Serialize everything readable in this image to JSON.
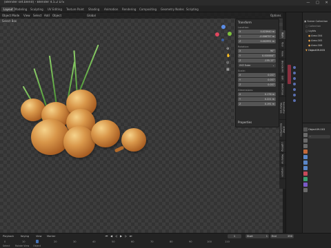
{
  "window": {
    "title": "[Blender set.blend] - Blender 4.5.2 LTS",
    "controls": [
      "—",
      "□",
      "✕"
    ]
  },
  "workspaces": [
    "Layout",
    "Modeling",
    "Sculpting",
    "UV Editing",
    "Texture Paint",
    "Shading",
    "Animation",
    "Rendering",
    "Compositing",
    "Geometry Nodes",
    "Scripting"
  ],
  "viewport": {
    "header": {
      "mode": "Object Mode",
      "view": "View",
      "select": "Select",
      "add": "Add",
      "object": "Object",
      "transform": "Global",
      "options": "Options"
    },
    "header2": {
      "label": "Select Box"
    }
  },
  "npanel": {
    "transform_header": "Transform",
    "location_label": "Location:",
    "location": [
      {
        "axis": "X",
        "value": "0.023940 m"
      },
      {
        "axis": "Y",
        "value": "-0.006757 m"
      },
      {
        "axis": "Z",
        "value": "0.002991 m"
      }
    ],
    "rotation_label": "Rotation:",
    "rotation": [
      {
        "axis": "X",
        "value": "90°"
      },
      {
        "axis": "Y",
        "value": "0.000004°"
      },
      {
        "axis": "Z",
        "value": "-155.12°"
      }
    ],
    "rotation_mode": "XYZ Euler",
    "scale_label": "Scale:",
    "scale": [
      {
        "axis": "X",
        "value": "0.037"
      },
      {
        "axis": "Y",
        "value": "0.037"
      },
      {
        "axis": "Z",
        "value": "0.037"
      }
    ],
    "dimensions_label": "Dimensions:",
    "dimensions": [
      {
        "axis": "X",
        "value": "0.176 m"
      },
      {
        "axis": "Y",
        "value": "0.221 m"
      },
      {
        "axis": "Z",
        "value": "0.191 m"
      }
    ],
    "properties_header": "Properties"
  },
  "vtabs": [
    "Item",
    "Tool",
    "View",
    "BlenderKit",
    "Edit",
    "Sketchfab",
    "Geometry Materials",
    "3DMZ QuickPacks",
    "Lighting",
    "Material",
    "surgeon"
  ],
  "outliner": {
    "header": "Scene Collection",
    "rows": [
      "Collection",
      "Lights",
      "Area.004",
      "Area.005",
      "Area.006",
      "Object09.003"
    ]
  },
  "properties": {
    "object_name": "Object09.003",
    "search_placeholder": "⌕"
  },
  "timeline": {
    "playback": "Playback",
    "keying": "Keying",
    "view": "View",
    "marker": "Marker",
    "current_frame": "1",
    "start_label": "Start",
    "start_value": "1",
    "end_label": "End",
    "end_value": "250",
    "ticks": [
      "0",
      "10",
      "20",
      "30",
      "40",
      "50",
      "60",
      "70",
      "80",
      "90",
      "100",
      "110"
    ],
    "status_left": "Select",
    "status_mid": "Rotate View",
    "status_right": "Object"
  },
  "colors": {
    "accent": "#4772b3",
    "active_tab": "#3a3a3a"
  }
}
